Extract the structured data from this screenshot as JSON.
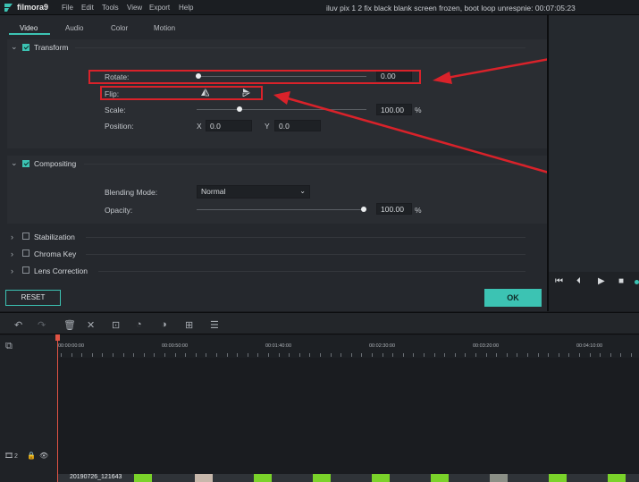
{
  "app": {
    "name": "filmora9",
    "menu": [
      "File",
      "Edit",
      "Tools",
      "View",
      "Export",
      "Help"
    ],
    "window_title": "iluv pix 1 2 fix black blank screen frozen, boot loop unrespnie:  00:07:05:23"
  },
  "tabs": [
    "Video",
    "Audio",
    "Color",
    "Motion"
  ],
  "active_tab": "Video",
  "transform": {
    "title": "Transform",
    "rotate_label": "Rotate:",
    "rotate_value": "0.00",
    "flip_label": "Flip:",
    "scale_label": "Scale:",
    "scale_value": "100.00",
    "scale_unit": "%",
    "position_label": "Position:",
    "x_label": "X",
    "x_value": "0.0",
    "y_label": "Y",
    "y_value": "0.0",
    "rotate_fraction": 0.0,
    "scale_fraction": 0.25
  },
  "compositing": {
    "title": "Compositing",
    "blending_label": "Blending Mode:",
    "blending_value": "Normal",
    "opacity_label": "Opacity:",
    "opacity_value": "100.00",
    "opacity_unit": "%",
    "opacity_fraction": 1.0
  },
  "collapsed_sections": [
    "Stabilization",
    "Chroma Key",
    "Lens Correction"
  ],
  "buttons": {
    "reset": "RESET",
    "ok": "OK"
  },
  "timeline": {
    "ruler_labels": [
      "00:00:00:00",
      "00:00:50:00",
      "00:01:40:00",
      "00:02:30:00",
      "00:03:20:00",
      "00:04:10:00"
    ],
    "track_number": "2",
    "clip_name": "20190726_121643"
  },
  "colors": {
    "accent": "#3cc3b3",
    "annotation": "#d9222a",
    "clip": "#7ad22a"
  },
  "icons": [
    "filmora-logo-icon",
    "undo-icon",
    "redo-icon",
    "delete-icon",
    "cut-icon",
    "crop-icon",
    "speed-icon",
    "color-icon",
    "split-screen-icon",
    "audio-mixer-icon",
    "add-track-icon",
    "lock-icon",
    "eye-icon",
    "flip-horizontal-icon",
    "flip-vertical-icon"
  ]
}
